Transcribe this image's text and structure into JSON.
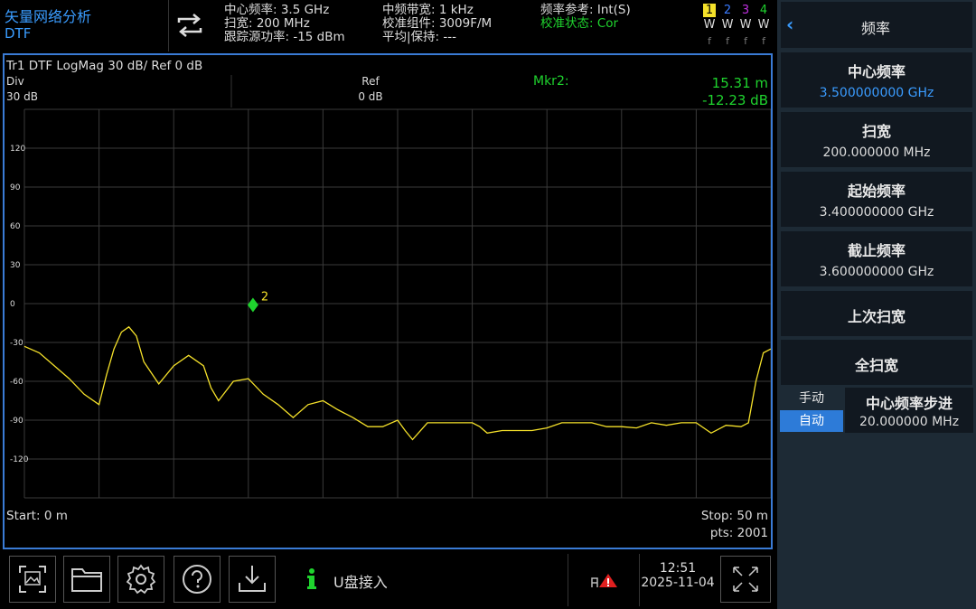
{
  "mode": {
    "title": "矢量网络分析",
    "sub": "DTF"
  },
  "status": {
    "center_freq": "中心频率: 3.5 GHz",
    "span": "扫宽: 200 MHz",
    "source_power": "跟踪源功率: -15 dBm",
    "if_bw": "中频带宽: 1 kHz",
    "cal_kit": "校准组件: 3009F/M",
    "avg_hold": "平均|保持: ---",
    "freq_ref": "频率参考: Int(S)",
    "cal_state": "校准状态: Cor"
  },
  "traces": [
    {
      "num": "1",
      "w": "W",
      "f": "f",
      "color": "#f5e12a"
    },
    {
      "num": "2",
      "w": "W",
      "f": "f",
      "color": "#3a7bff"
    },
    {
      "num": "3",
      "w": "W",
      "f": "f",
      "color": "#c030e0"
    },
    {
      "num": "4",
      "w": "W",
      "f": "f",
      "color": "#1fd32e"
    }
  ],
  "panel": {
    "title": "频率",
    "center": {
      "label": "中心频率",
      "value": "3.500000000 GHz"
    },
    "span": {
      "label": "扫宽",
      "value": "200.000000 MHz"
    },
    "start": {
      "label": "起始频率",
      "value": "3.400000000 GHz"
    },
    "stop": {
      "label": "截止频率",
      "value": "3.600000000 GHz"
    },
    "last_span": "上次扫宽",
    "full_span": "全扫宽",
    "manual": "手动",
    "auto": "自动",
    "step": {
      "label": "中心频率步进",
      "value": "20.000000 MHz"
    }
  },
  "plot": {
    "trace_title": "Tr1 DTF LogMag 30 dB/ Ref 0 dB",
    "div_label": "Div",
    "div_value": "30 dB",
    "ref_label": "Ref",
    "ref_value": "0 dB",
    "mkr_label": "Mkr2:",
    "mkr_x": "15.31 m",
    "mkr_y": "-12.23 dB",
    "start": "Start: 0 m",
    "stop": "Stop: 50 m",
    "pts": "pts: 2001",
    "y_ticks": [
      "120",
      "90",
      "60",
      "30",
      "0",
      "-30",
      "-60",
      "-90",
      "-120"
    ],
    "marker_num": "2"
  },
  "chart_data": {
    "type": "line",
    "title": "Tr1 DTF LogMag 30 dB/ Ref 0 dB",
    "xlabel": "",
    "ylabel": "",
    "xlim": [
      0,
      50
    ],
    "ylim": [
      -150,
      150
    ],
    "y_ticks": [
      120,
      90,
      60,
      30,
      0,
      -30,
      -60,
      -90,
      -120
    ],
    "grid": true,
    "series": [
      {
        "color": "#f5e12a",
        "x": [
          0,
          1,
          2,
          3,
          4,
          5,
          5.5,
          6,
          6.5,
          7,
          7.5,
          8,
          9,
          10,
          11,
          12,
          12.5,
          13,
          14,
          15,
          16,
          17,
          17.5,
          18,
          19,
          20,
          21,
          22,
          23,
          24,
          25,
          25.5,
          26,
          27,
          28,
          29,
          30,
          30.5,
          31,
          32,
          33,
          34,
          35,
          36,
          37,
          38,
          39,
          40,
          41,
          42,
          43,
          44,
          45,
          46,
          47,
          48,
          48.5,
          49,
          49.5,
          50
        ],
        "y": [
          -33,
          -38,
          -48,
          -58,
          -70,
          -78,
          -55,
          -35,
          -22,
          -18,
          -25,
          -45,
          -62,
          -48,
          -40,
          -48,
          -65,
          -75,
          -60,
          -58,
          -70,
          -78,
          -83,
          -88,
          -78,
          -75,
          -82,
          -88,
          -95,
          -95,
          -90,
          -98,
          -105,
          -92,
          -92,
          -92,
          -92,
          -95,
          -100,
          -98,
          -98,
          -98,
          -96,
          -92,
          -92,
          -92,
          -95,
          -95,
          -96,
          -92,
          -94,
          -92,
          -92,
          -100,
          -94,
          -95,
          -92,
          -60,
          -38,
          -35
        ]
      }
    ],
    "marker": {
      "name": "2",
      "x": 15.31,
      "y": -12.23
    }
  },
  "bottom": {
    "usb_msg": "U盘接入",
    "time": "12:51",
    "date": "2025-11-04"
  }
}
